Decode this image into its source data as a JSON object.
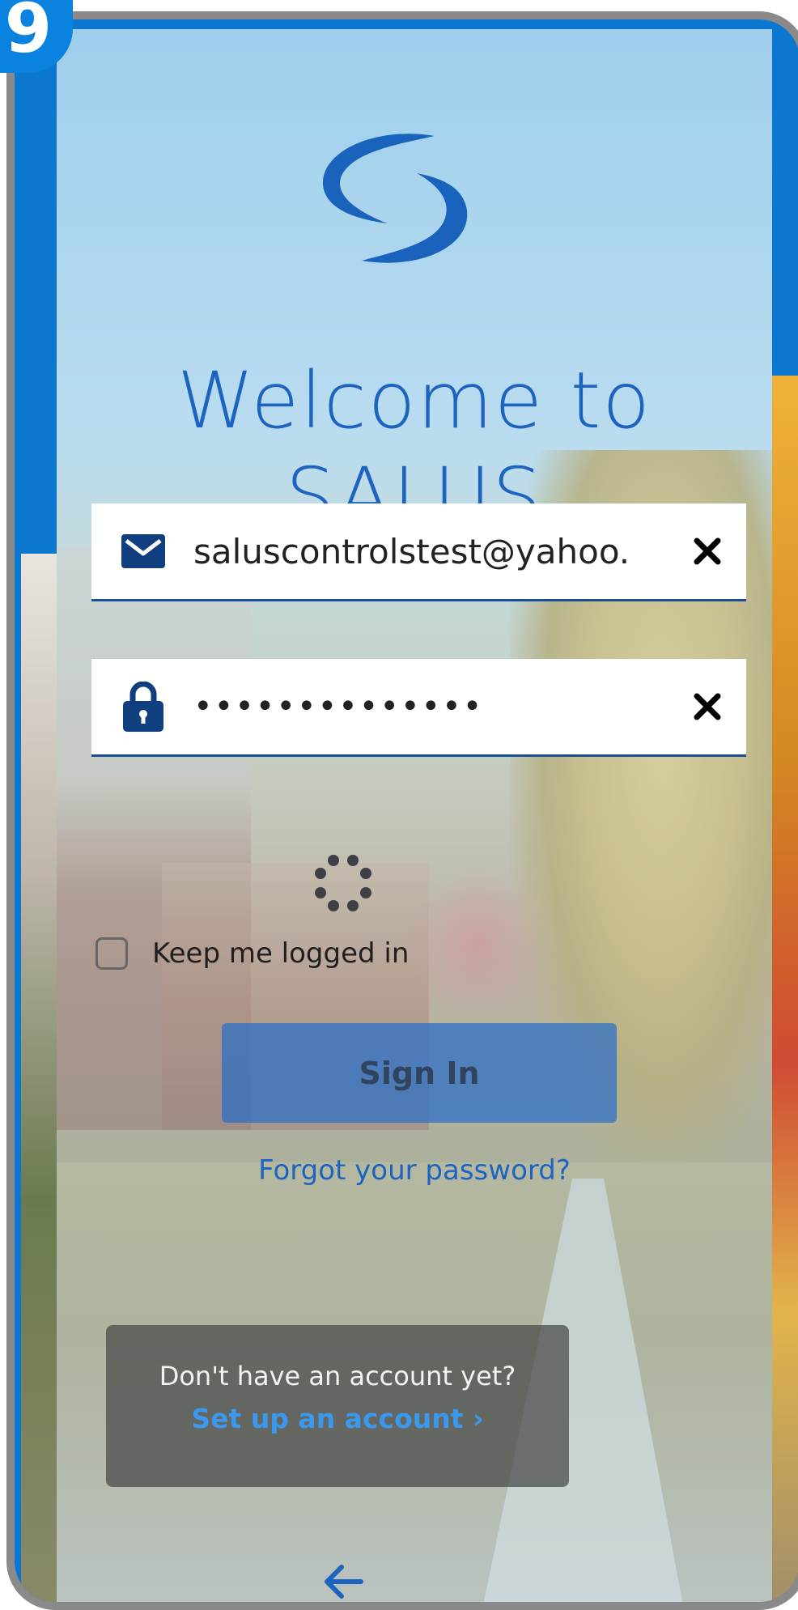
{
  "step_badge": "9",
  "welcome": {
    "line1": "Welcome to",
    "line2": "SALUS"
  },
  "email": {
    "icon": "envelope-icon",
    "value": "saluscontrolstest@yahoo.",
    "clear_icon": "close-icon"
  },
  "password": {
    "icon": "lock-icon",
    "value": "••••••••••••••",
    "clear_icon": "close-icon"
  },
  "keep_logged_in": {
    "label": "Keep me logged in",
    "checked": false
  },
  "signin": {
    "label": "Sign In",
    "loading": true
  },
  "forgot": "Forgot your password?",
  "signup": {
    "question": "Don't have an account yet?",
    "link": "Set up an account ›"
  },
  "colors": {
    "brand_blue": "#1d64c0",
    "link_blue": "#3a98ee",
    "field_underline": "#1a4f95",
    "badge_blue": "#0a82e0"
  },
  "back_icon": "arrow-left-icon"
}
